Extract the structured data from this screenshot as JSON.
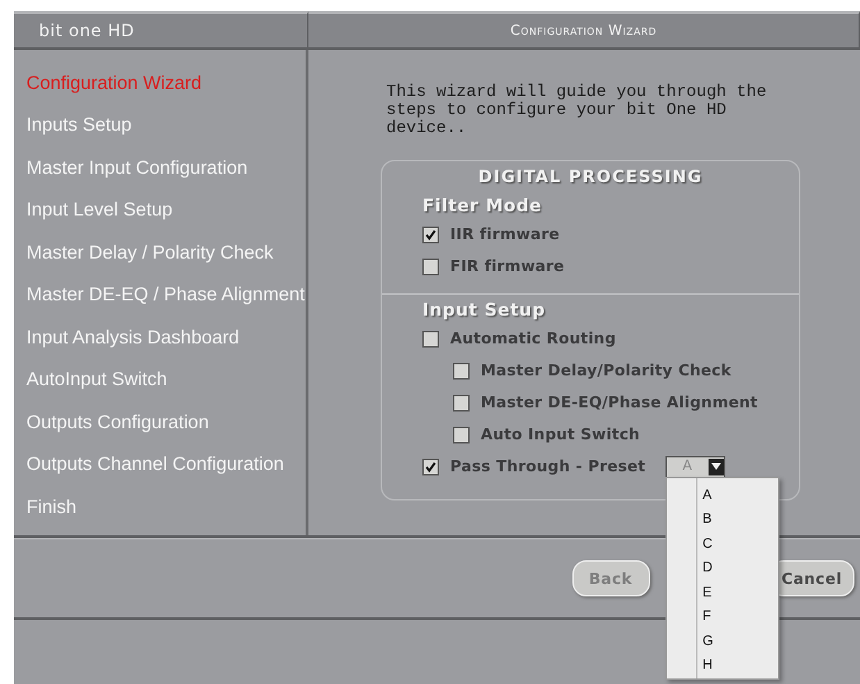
{
  "app_title": "bit one HD",
  "wizard_title": "Configuration Wizard",
  "sidebar": {
    "items": [
      {
        "label": "Configuration Wizard",
        "selected": true
      },
      {
        "label": "Inputs Setup",
        "selected": false
      },
      {
        "label": "Master Input Configuration",
        "selected": false
      },
      {
        "label": "Input Level Setup",
        "selected": false
      },
      {
        "label": "Master Delay / Polarity Check",
        "selected": false
      },
      {
        "label": "Master DE-EQ / Phase Alignment",
        "selected": false
      },
      {
        "label": "Input Analysis Dashboard",
        "selected": false
      },
      {
        "label": "AutoInput Switch",
        "selected": false
      },
      {
        "label": "Outputs Configuration",
        "selected": false
      },
      {
        "label": "Outputs Channel Configuration",
        "selected": false
      },
      {
        "label": "Finish",
        "selected": false
      }
    ]
  },
  "intro": "This wizard will guide you through the steps to configure your bit One HD device..",
  "panel": {
    "title": "DIGITAL PROCESSING",
    "sections": [
      {
        "title": "Filter Mode",
        "options": [
          {
            "kind": "checkbox",
            "label": "IIR firmware",
            "checked": true
          },
          {
            "kind": "checkbox",
            "label": "FIR firmware",
            "checked": false
          }
        ]
      },
      {
        "title": "Input Setup",
        "options": [
          {
            "kind": "checkbox",
            "label": "Automatic Routing",
            "checked": false,
            "children": [
              {
                "kind": "checkbox",
                "label": "Master Delay/Polarity Check",
                "checked": false
              },
              {
                "kind": "checkbox",
                "label": "Master DE-EQ/Phase Alignment",
                "checked": false
              },
              {
                "kind": "checkbox",
                "label": "Auto Input Switch",
                "checked": false
              }
            ]
          },
          {
            "kind": "preset",
            "label": "Pass Through - Preset",
            "checked": true,
            "value": "A",
            "expanded": true,
            "options": [
              "A",
              "B",
              "C",
              "D",
              "E",
              "F",
              "G",
              "H"
            ]
          }
        ]
      }
    ]
  },
  "buttons": [
    {
      "label": "Back",
      "disabled": true
    },
    {
      "label": "Cancel",
      "disabled": false
    }
  ]
}
